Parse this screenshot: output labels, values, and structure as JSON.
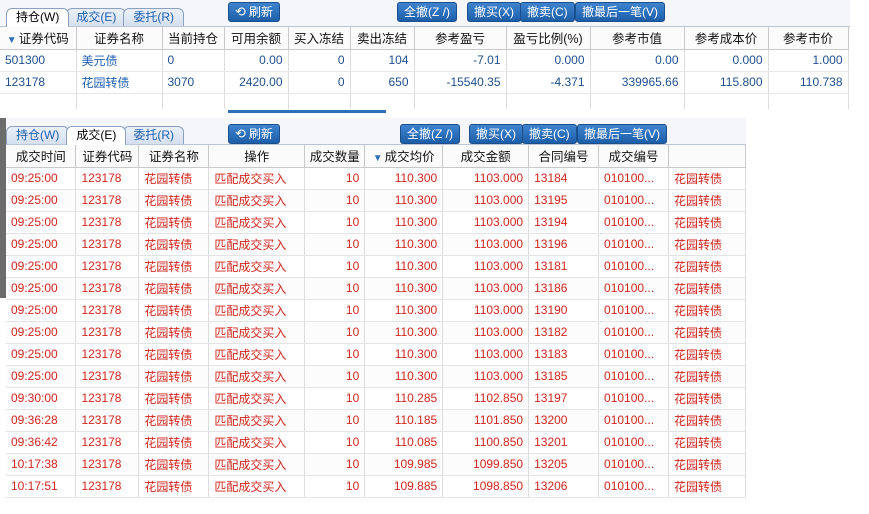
{
  "top": {
    "tabs": [
      {
        "label": "持仓(W)",
        "active": true
      },
      {
        "label": "成交(E)",
        "active": false
      },
      {
        "label": "委托(R)",
        "active": false
      }
    ],
    "refresh_label": "刷新",
    "buttons": {
      "cancel_all": "全撤(Z /)",
      "cancel_buy": "撤买(X)",
      "cancel_sell": "撤卖(C)",
      "cancel_last": "撤最后一笔(V)"
    },
    "columns": [
      "证券代码",
      "证券名称",
      "当前持仓",
      "可用余额",
      "买入冻结",
      "卖出冻结",
      "参考盈亏",
      "盈亏比例(%)",
      "参考市值",
      "参考成本价",
      "参考市价"
    ],
    "rows": [
      [
        "501300",
        "美元债",
        "0",
        "0.00",
        "0",
        "104",
        "-7.01",
        "0.000",
        "0.00",
        "0.000",
        "1.000"
      ],
      [
        "123178",
        "花园转债",
        "3070",
        "2420.00",
        "0",
        "650",
        "-15540.35",
        "-4.371",
        "339965.66",
        "115.800",
        "110.738"
      ]
    ]
  },
  "bottom": {
    "tabs": [
      {
        "label": "持仓(W)",
        "active": false
      },
      {
        "label": "成交(E)",
        "active": true
      },
      {
        "label": "委托(R)",
        "active": false
      }
    ],
    "refresh_label": "刷新",
    "buttons": {
      "cancel_all": "全撤(Z /)",
      "cancel_buy": "撤买(X)",
      "cancel_sell": "撤卖(C)",
      "cancel_last": "撤最后一笔(V)"
    },
    "columns": [
      "成交时间",
      "证券代码",
      "证券名称",
      "操作",
      "成交数量",
      "成交均价",
      "成交金额",
      "合同编号",
      "成交编号",
      ""
    ],
    "rows": [
      [
        "09:25:00",
        "123178",
        "花园转债",
        "匹配成交买入",
        "10",
        "110.300",
        "1103.000",
        "13184",
        "010100...",
        "花园转债"
      ],
      [
        "09:25:00",
        "123178",
        "花园转债",
        "匹配成交买入",
        "10",
        "110.300",
        "1103.000",
        "13195",
        "010100...",
        "花园转债"
      ],
      [
        "09:25:00",
        "123178",
        "花园转债",
        "匹配成交买入",
        "10",
        "110.300",
        "1103.000",
        "13194",
        "010100...",
        "花园转债"
      ],
      [
        "09:25:00",
        "123178",
        "花园转债",
        "匹配成交买入",
        "10",
        "110.300",
        "1103.000",
        "13196",
        "010100...",
        "花园转债"
      ],
      [
        "09:25:00",
        "123178",
        "花园转债",
        "匹配成交买入",
        "10",
        "110.300",
        "1103.000",
        "13181",
        "010100...",
        "花园转债"
      ],
      [
        "09:25:00",
        "123178",
        "花园转债",
        "匹配成交买入",
        "10",
        "110.300",
        "1103.000",
        "13186",
        "010100...",
        "花园转债"
      ],
      [
        "09:25:00",
        "123178",
        "花园转债",
        "匹配成交买入",
        "10",
        "110.300",
        "1103.000",
        "13190",
        "010100...",
        "花园转债"
      ],
      [
        "09:25:00",
        "123178",
        "花园转债",
        "匹配成交买入",
        "10",
        "110.300",
        "1103.000",
        "13182",
        "010100...",
        "花园转债"
      ],
      [
        "09:25:00",
        "123178",
        "花园转债",
        "匹配成交买入",
        "10",
        "110.300",
        "1103.000",
        "13183",
        "010100...",
        "花园转债"
      ],
      [
        "09:25:00",
        "123178",
        "花园转债",
        "匹配成交买入",
        "10",
        "110.300",
        "1103.000",
        "13185",
        "010100...",
        "花园转债"
      ],
      [
        "09:30:00",
        "123178",
        "花园转债",
        "匹配成交买入",
        "10",
        "110.285",
        "1102.850",
        "13197",
        "010100...",
        "花园转债"
      ],
      [
        "09:36:28",
        "123178",
        "花园转债",
        "匹配成交买入",
        "10",
        "110.185",
        "1101.850",
        "13200",
        "010100...",
        "花园转债"
      ],
      [
        "09:36:42",
        "123178",
        "花园转债",
        "匹配成交买入",
        "10",
        "110.085",
        "1100.850",
        "13201",
        "010100...",
        "花园转债"
      ],
      [
        "10:17:38",
        "123178",
        "花园转债",
        "匹配成交买入",
        "10",
        "109.985",
        "1099.850",
        "13205",
        "010100...",
        "花园转债"
      ],
      [
        "10:17:51",
        "123178",
        "花园转债",
        "匹配成交买入",
        "10",
        "109.885",
        "1098.850",
        "13206",
        "010100...",
        "花园转债"
      ]
    ]
  },
  "colors": {
    "accent_blue": "#2f6fb8",
    "trade_red": "#d0261e",
    "holding_blue": "#1f4f8f"
  },
  "icons": {
    "refresh": "refresh-icon",
    "sort": "sort-desc-icon"
  }
}
